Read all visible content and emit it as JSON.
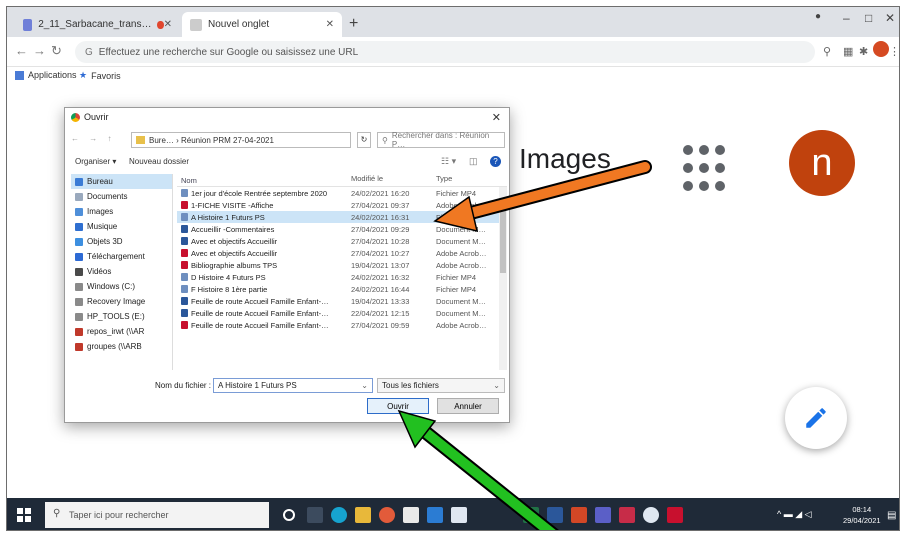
{
  "browser": {
    "tabs": [
      {
        "label": "2_11_Sarbacane_trans…",
        "active": false
      },
      {
        "label": "Nouvel onglet",
        "active": true
      }
    ],
    "omnibox_placeholder": "Effectuez une recherche sur Google ou saisissez une URL",
    "bookmarks": [
      "Applications",
      "Favoris"
    ]
  },
  "google_page": {
    "images_link": "Images",
    "avatar_letter": "n",
    "icons": [
      "apps-grid-icon",
      "edit-pencil-icon"
    ]
  },
  "dialog": {
    "title": "Ouvrir",
    "breadcrumb": "Bure… › Réunion PRM 27-04-2021",
    "search_placeholder": "Rechercher dans : Réunion P…",
    "organize_label": "Organiser ▾",
    "new_folder_label": "Nouveau dossier",
    "nav_items": [
      {
        "label": "Bureau",
        "color": "#3a7bd5",
        "selected": true
      },
      {
        "label": "Documents",
        "color": "#9aa9bd",
        "selected": false
      },
      {
        "label": "Images",
        "color": "#4f8fd9",
        "selected": false
      },
      {
        "label": "Musique",
        "color": "#2f6fd0",
        "selected": false
      },
      {
        "label": "Objets 3D",
        "color": "#3d8fe0",
        "selected": false
      },
      {
        "label": "Téléchargement",
        "color": "#2d6ad4",
        "selected": false
      },
      {
        "label": "Vidéos",
        "color": "#4a4a4a",
        "selected": false
      },
      {
        "label": "Windows (C:)",
        "color": "#8a8a8a",
        "selected": false
      },
      {
        "label": "Recovery Image",
        "color": "#8a8a8a",
        "selected": false
      },
      {
        "label": "HP_TOOLS (E:)",
        "color": "#8a8a8a",
        "selected": false
      },
      {
        "label": "repos_irwt (\\\\AR",
        "color": "#c0392b",
        "selected": false
      },
      {
        "label": "groupes (\\\\ARB",
        "color": "#c0392b",
        "selected": false
      }
    ],
    "columns": [
      "Nom",
      "Modifié le",
      "Type"
    ],
    "files": [
      {
        "name": "1er jour d'école Rentrée septembre 2020",
        "date": "24/02/2021 16:20",
        "type": "Fichier MP4",
        "kind": "video",
        "selected": false
      },
      {
        "name": "1-FICHE VISITE -Affiche",
        "date": "27/04/2021 09:37",
        "type": "Adobe Acrob…",
        "kind": "pdf",
        "selected": false
      },
      {
        "name": "A Histoire 1 Futurs PS",
        "date": "24/02/2021 16:31",
        "type": "Fichier MP4",
        "kind": "video",
        "selected": true
      },
      {
        "name": "Accueillir -Commentaires",
        "date": "27/04/2021 09:29",
        "type": "Document M…",
        "kind": "doc",
        "selected": false
      },
      {
        "name": "Avec et objectifs Accueillir",
        "date": "27/04/2021 10:28",
        "type": "Document M…",
        "kind": "doc",
        "selected": false
      },
      {
        "name": "Avec et objectifs Accueillir",
        "date": "27/04/2021 10:27",
        "type": "Adobe Acrob…",
        "kind": "pdf",
        "selected": false
      },
      {
        "name": "Bibliographie albums TPS",
        "date": "19/04/2021 13:07",
        "type": "Adobe Acrob…",
        "kind": "pdf",
        "selected": false
      },
      {
        "name": "D Histoire 4 Futurs PS",
        "date": "24/02/2021 16:32",
        "type": "Fichier MP4",
        "kind": "video",
        "selected": false
      },
      {
        "name": "F Histoire 8 1ère partie",
        "date": "24/02/2021 16:44",
        "type": "Fichier MP4",
        "kind": "video",
        "selected": false
      },
      {
        "name": "Feuille de route Accueil Famille Enfant-…",
        "date": "19/04/2021 13:33",
        "type": "Document M…",
        "kind": "doc",
        "selected": false
      },
      {
        "name": "Feuille de route Accueil Famille Enfant-…",
        "date": "22/04/2021 12:15",
        "type": "Document M…",
        "kind": "doc",
        "selected": false
      },
      {
        "name": "Feuille de route Accueil Famille Enfant-…",
        "date": "27/04/2021 09:59",
        "type": "Adobe Acrob…",
        "kind": "pdf",
        "selected": false
      }
    ],
    "filename_label": "Nom du fichier :",
    "filename_value": "A Histoire 1 Futurs PS",
    "filetype_value": "Tous les fichiers",
    "open_label": "Ouvrir",
    "cancel_label": "Annuler"
  },
  "taskbar": {
    "search_placeholder": "Taper ici pour rechercher",
    "time": "08:14",
    "date": "29/04/2021"
  },
  "colors": {
    "orange_arrow": "#f07822",
    "green_arrow": "#22c020",
    "avatar": "#c0420d",
    "taskbar": "#1f2a38"
  }
}
